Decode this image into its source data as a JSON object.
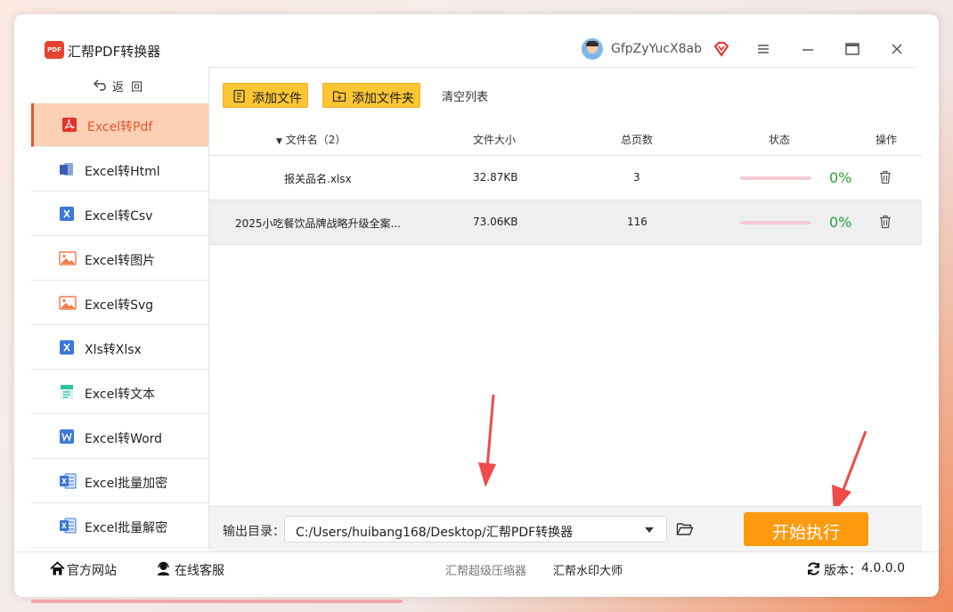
{
  "app": {
    "logo_text": "PDF",
    "title": "汇帮PDF转换器"
  },
  "user": {
    "name": "GfpZyYucX8ab",
    "vip_icon": "vip-diamond-icon"
  },
  "window_controls": [
    "menu-icon",
    "minimize-icon",
    "maximize-icon",
    "close-icon"
  ],
  "sidebar": {
    "back_label": "返 回",
    "items": [
      {
        "label": "Excel转Pdf",
        "icon": "pdf-icon",
        "active": true
      },
      {
        "label": "Excel转Html",
        "icon": "html-icon"
      },
      {
        "label": "Excel转Csv",
        "icon": "excel-x-icon"
      },
      {
        "label": "Excel转图片",
        "icon": "image-icon"
      },
      {
        "label": "Excel转Svg",
        "icon": "image-icon"
      },
      {
        "label": "Xls转Xlsx",
        "icon": "excel-x-icon"
      },
      {
        "label": "Excel转文本",
        "icon": "text-icon"
      },
      {
        "label": "Excel转Word",
        "icon": "word-icon"
      },
      {
        "label": "Excel批量加密",
        "icon": "excel-file-icon"
      },
      {
        "label": "Excel批量解密",
        "icon": "excel-file-icon"
      }
    ]
  },
  "toolbar": {
    "add_file": "添加文件",
    "add_folder": "添加文件夹",
    "clear_list": "清空列表"
  },
  "table": {
    "headers": {
      "name": "文件名（2）",
      "size": "文件大小",
      "pages": "总页数",
      "status": "状态",
      "action": "操作"
    },
    "rows": [
      {
        "name": "报关品名.xlsx",
        "size": "32.87KB",
        "pages": "3",
        "progress": 0,
        "percent": "0%"
      },
      {
        "name": "2025小吃餐饮品牌战略升级全案...",
        "size": "73.06KB",
        "pages": "116",
        "progress": 0,
        "percent": "0%"
      }
    ]
  },
  "output": {
    "label": "输出目录：",
    "path": "C:/Users/huibang168/Desktop/汇帮PDF转换器"
  },
  "start_button": "开始执行",
  "footer": {
    "website": "官方网站",
    "support": "在线客服",
    "link1": "汇帮超级压缩器",
    "link2": "汇帮水印大师",
    "version_label": "版本：",
    "version": "4.0.0.0"
  },
  "colors": {
    "accent": "#e4572e",
    "button_yellow": "#fcc633",
    "start_orange": "#ff9a0f",
    "percent_green": "#29a33a"
  }
}
